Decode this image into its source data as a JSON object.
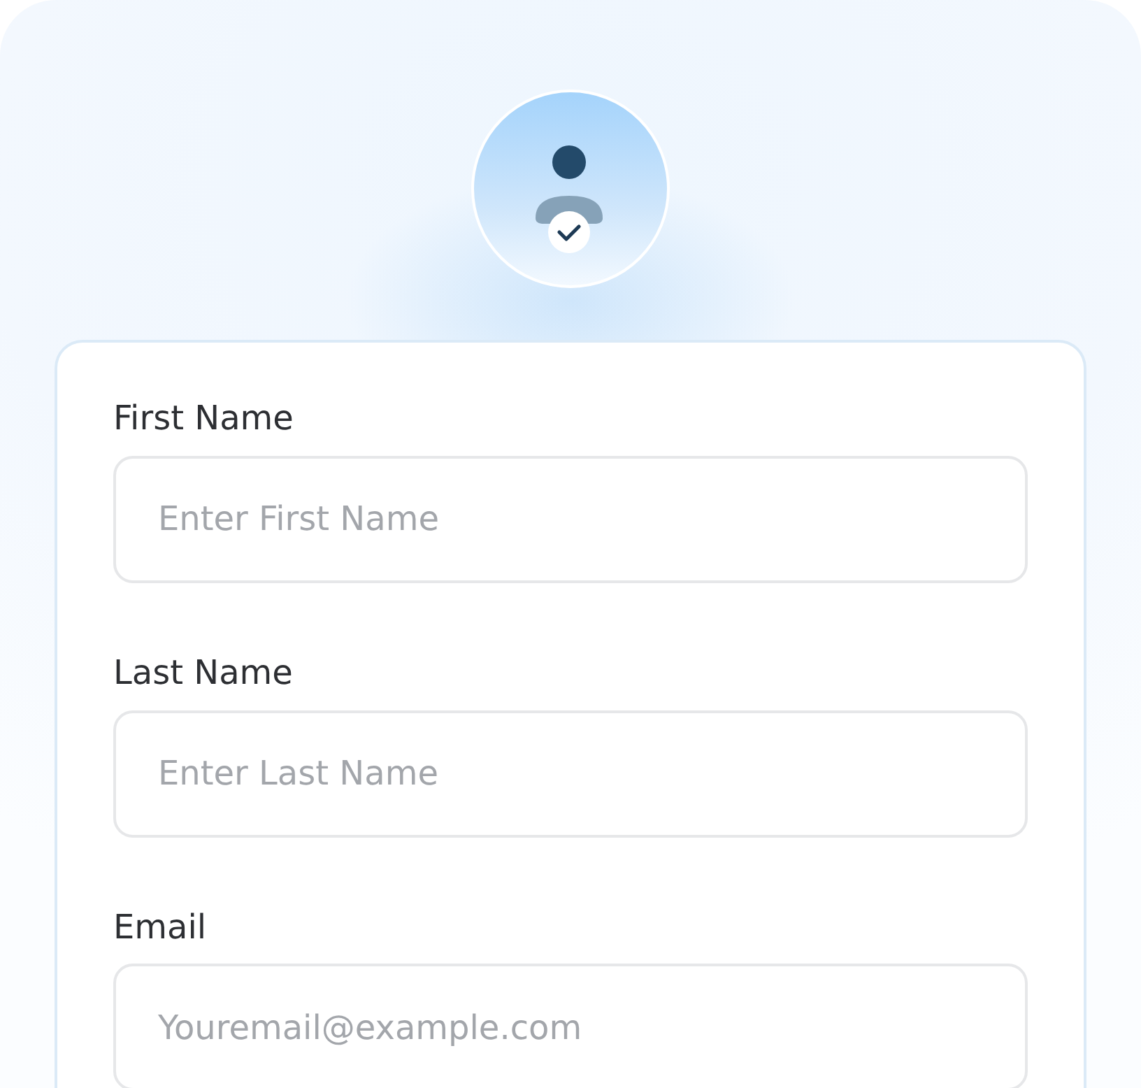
{
  "form": {
    "fields": [
      {
        "label": "First Name",
        "placeholder": "Enter First Name"
      },
      {
        "label": "Last Name",
        "placeholder": "Enter Last Name"
      },
      {
        "label": "Email",
        "placeholder": "Youremail@example.com"
      }
    ]
  }
}
